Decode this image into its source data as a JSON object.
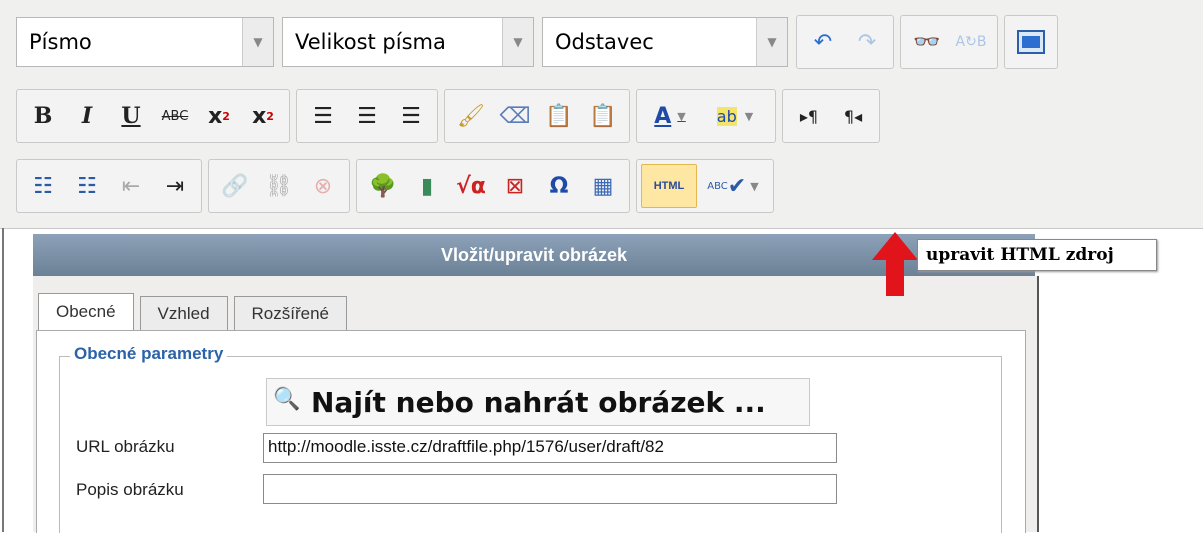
{
  "toolbar": {
    "font_select": "Písmo",
    "size_select": "Velikost písma",
    "format_select": "Odstavec",
    "html_label": "HTML",
    "abc_label": "ABC"
  },
  "dialog": {
    "title": "Vložit/upravit obrázek",
    "tabs": [
      "Obecné",
      "Vzhled",
      "Rozšířené"
    ],
    "legend": "Obecné parametry",
    "find_button": "Najít nebo nahrát obrázek ...",
    "url_label": "URL obrázku",
    "url_value": "http://moodle.isste.cz/draftfile.php/1576/user/draft/82",
    "desc_label": "Popis obrázku",
    "desc_value": ""
  },
  "tooltip": "upravit HTML zdroj",
  "colors": {
    "accent_blue": "#2b63a8",
    "arrow_red": "#e0141a",
    "html_highlight": "#fde7a2"
  }
}
